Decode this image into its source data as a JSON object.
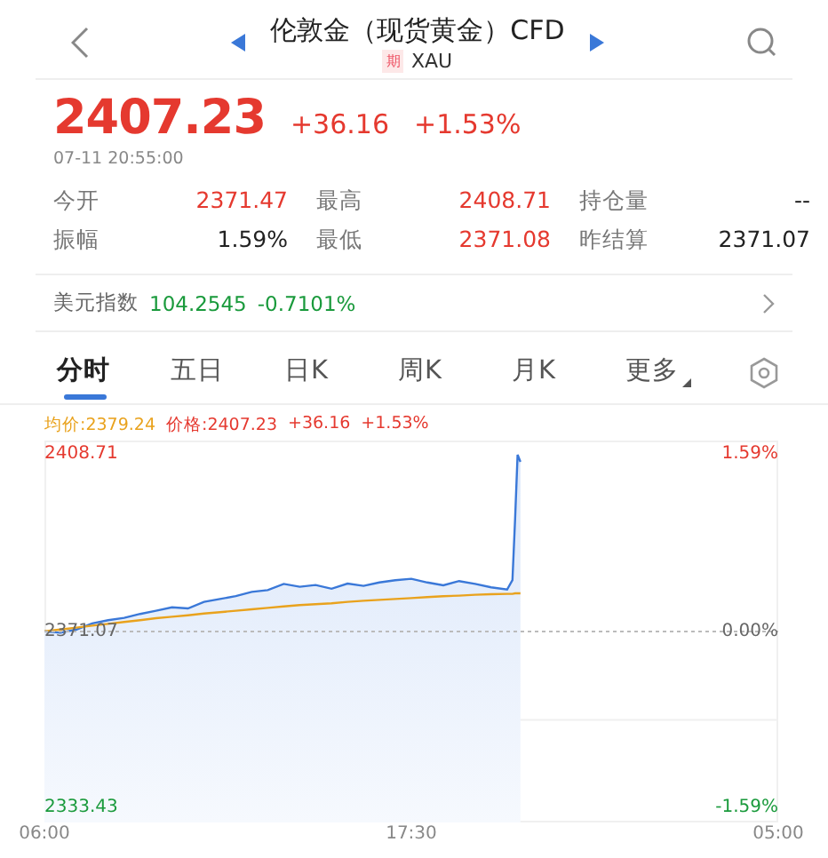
{
  "header": {
    "title": "伦敦金（现货黄金）CFD",
    "badge": "期",
    "symbol": "XAU"
  },
  "quote": {
    "price": "2407.23",
    "change": "+36.16",
    "change_pct": "+1.53%",
    "time": "07-11 20:55:00"
  },
  "stats": [
    {
      "label": "今开",
      "value": "2371.47",
      "kind": "up"
    },
    {
      "label": "最高",
      "value": "2408.71",
      "kind": "up"
    },
    {
      "label": "持仓量",
      "value": "--",
      "kind": "flat"
    },
    {
      "label": "振幅",
      "value": "1.59%",
      "kind": "flat"
    },
    {
      "label": "最低",
      "value": "2371.08",
      "kind": "up"
    },
    {
      "label": "昨结算",
      "value": "2371.07",
      "kind": "flat"
    }
  ],
  "index_row": {
    "label": "美元指数",
    "value": "104.2545",
    "change": "-0.7101%"
  },
  "tabs": [
    {
      "label": "分时",
      "selected": true
    },
    {
      "label": "五日",
      "selected": false
    },
    {
      "label": "日K",
      "selected": false
    },
    {
      "label": "周K",
      "selected": false
    },
    {
      "label": "月K",
      "selected": false
    },
    {
      "label": "更多",
      "selected": false
    }
  ],
  "chart": {
    "legend": [
      {
        "text": "均价:2379.24",
        "kind": "avg"
      },
      {
        "text": "价格:2407.23",
        "kind": "up"
      },
      {
        "text": "+36.16",
        "kind": "up"
      },
      {
        "text": "+1.53%",
        "kind": "up"
      }
    ],
    "x_end_label": "05:00",
    "right_labels": [
      {
        "text": "1.59%",
        "kind": "up"
      },
      {
        "text": "0.00%",
        "kind": "flat"
      },
      {
        "text": "-1.59%",
        "kind": "down"
      }
    ],
    "chart_data": {
      "type": "area",
      "x": [
        6,
        6.5,
        7,
        7.5,
        8,
        8.5,
        9,
        9.5,
        10,
        10.5,
        11,
        11.5,
        12,
        12.5,
        13,
        13.5,
        14,
        14.5,
        15,
        15.5,
        16,
        16.5,
        17,
        17.5,
        18,
        18.5,
        19,
        19.5,
        20,
        20.5,
        20.67,
        20.75,
        20.83,
        20.92
      ],
      "series": [
        {
          "type": "area",
          "color": "#3a78d8",
          "values": [
            2371.1,
            2370.8,
            2371.5,
            2372.8,
            2373.5,
            2374.0,
            2374.8,
            2375.5,
            2376.2,
            2376.0,
            2377.4,
            2378.0,
            2378.6,
            2379.5,
            2379.9,
            2381.2,
            2380.6,
            2381.0,
            2380.2,
            2381.3,
            2380.8,
            2381.5,
            2382.0,
            2382.3,
            2381.5,
            2380.9,
            2381.8,
            2381.2,
            2380.5,
            2380.0,
            2382.0,
            2395.0,
            2408.7,
            2407.2
          ]
        },
        {
          "type": "line",
          "color": "#e9a21d",
          "values": [
            2371.1,
            2371.5,
            2371.9,
            2372.3,
            2372.7,
            2373.1,
            2373.5,
            2373.9,
            2374.2,
            2374.5,
            2374.9,
            2375.2,
            2375.5,
            2375.8,
            2376.1,
            2376.4,
            2376.7,
            2376.9,
            2377.1,
            2377.4,
            2377.6,
            2377.8,
            2378.0,
            2378.2,
            2378.4,
            2378.6,
            2378.7,
            2378.9,
            2379.0,
            2379.1,
            2379.1,
            2379.2,
            2379.2,
            2379.2
          ]
        }
      ],
      "xlim": [
        6,
        29
      ],
      "ylim": [
        2330.4,
        2411.74
      ],
      "ref_lines": [
        {
          "axis": "y",
          "value": 2352.25
        }
      ],
      "xticks": [
        {
          "value": 6,
          "label": "06:00"
        },
        {
          "value": 17.5,
          "label": "17:30"
        }
      ],
      "yticks": [
        {
          "value": 2408.71,
          "label": "2408.71"
        },
        {
          "value": 2371.07,
          "label": "2371.07"
        },
        {
          "value": 2333.43,
          "label": "2333.43"
        }
      ]
    }
  }
}
